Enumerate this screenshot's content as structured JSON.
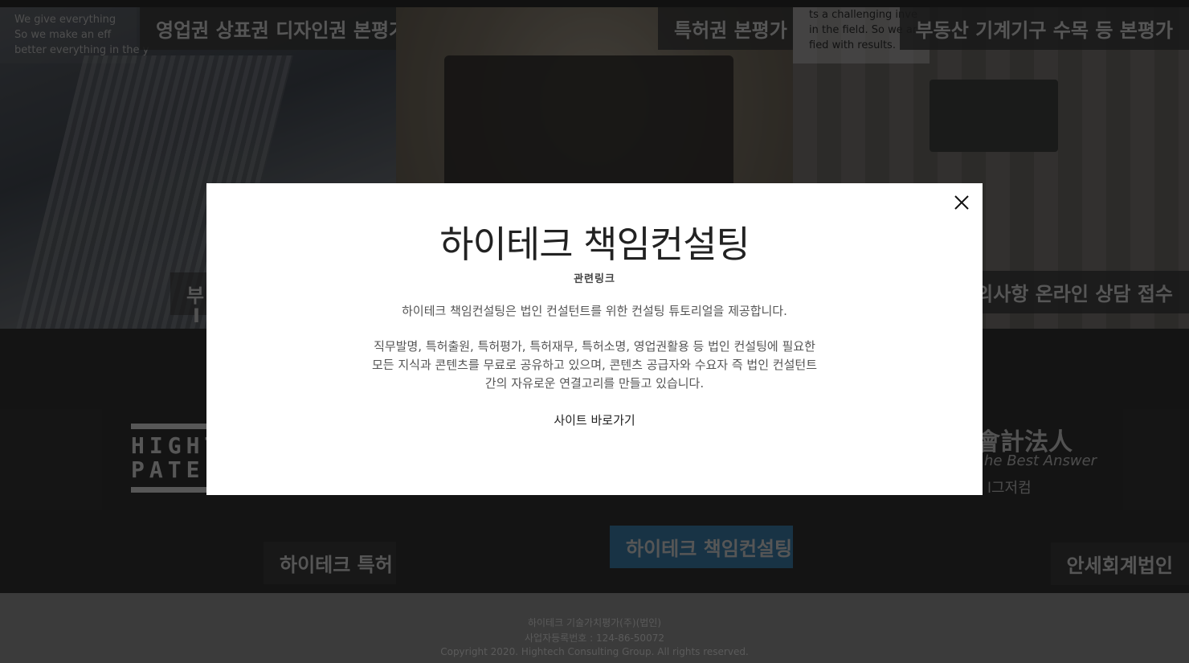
{
  "tiles": {
    "t1": {
      "label": "영업권 상표권 디자인권 본평가",
      "mid_label": "부",
      "mid_label2": "I",
      "note": [
        "We give everything",
        "So we make an eff",
        "better everything in the y"
      ]
    },
    "t2": {
      "label": "특허권 본평가"
    },
    "t3": {
      "label": "부동산 기계기구 수목 등 본평가",
      "mid_label": "문의사항 온라인 상담 접수",
      "note": [
        "ts a challenging inve",
        "in the field. So we ar",
        "fied with results."
      ]
    },
    "t4": {
      "label": "하이테크 특허",
      "logo_lines": [
        "HIGHT",
        "PATE"
      ]
    },
    "t5": {
      "label": "하이테크 책임컨설팅"
    },
    "t6": {
      "label": "안세회계법인",
      "logo_cjk": "會計法人",
      "logo_sub": "he Best Answer",
      "logo_sub2": "l그저컴"
    }
  },
  "footer": {
    "lines": [
      "하이테크 기술가치평가(주)(법인)",
      "사업자등록번호 : 124-86-50072",
      "Copyright 2020. Hightech Consulting Group. All rights reserved."
    ]
  },
  "modal": {
    "title": "하이테크 책임컨설팅",
    "subtitle": "관련링크",
    "desc1": "하이테크 책임컨설팅은 법인 컨설턴트를 위한 컨설팅 튜토리얼을 제공합니다.",
    "desc2": "직무발명, 특허출원, 특허평가, 특허재무, 특허소명, 영업권활용 등 법인 컨설팅에 필요한 모든 지식과 콘텐츠를 무료로 공유하고 있으며, 콘텐츠 공급자와 수요자 즉 법인 컨설턴트간의 자유로운 연결고리를 만들고 있습니다.",
    "link_label": "사이트 바로가기",
    "close_icon": "close-icon"
  }
}
